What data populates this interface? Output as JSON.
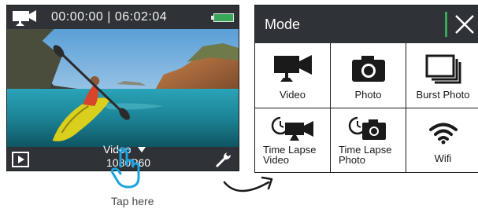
{
  "camera_screen": {
    "elapsed_time": "00:00:00",
    "separator": "|",
    "remaining_time": "06:02:04",
    "current_mode": "Video",
    "resolution": "1080P60",
    "battery_color": "#3aa85a"
  },
  "hint": {
    "caption": "Tap here"
  },
  "mode_menu": {
    "title": "Mode",
    "accent_color": "#3aa85a",
    "items": [
      {
        "label": "Video",
        "icon": "video-camera-icon"
      },
      {
        "label": "Photo",
        "icon": "photo-camera-icon"
      },
      {
        "label": "Burst Photo",
        "icon": "burst-photo-icon"
      },
      {
        "label": "Time Lapse Video",
        "icon": "time-lapse-video-icon"
      },
      {
        "label": "Time Lapse Photo",
        "icon": "time-lapse-photo-icon"
      },
      {
        "label": "Wifi",
        "icon": "wifi-icon"
      }
    ]
  }
}
